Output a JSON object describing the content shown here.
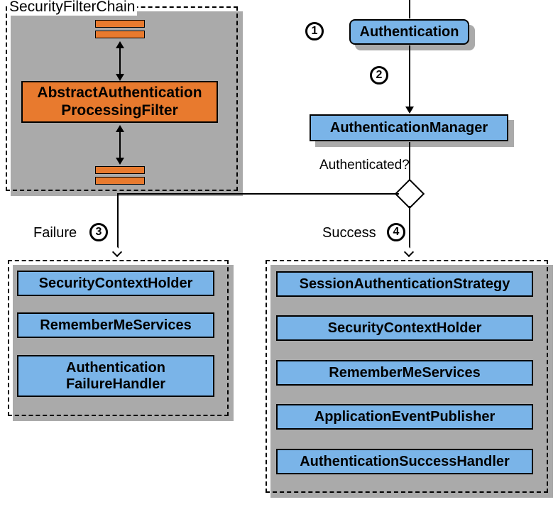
{
  "filterChain": {
    "title": "SecurityFilterChain",
    "mainFilter": "AbstractAuthentication\nProcessingFilter"
  },
  "right": {
    "authentication": "Authentication",
    "authManager": "AuthenticationManager",
    "question": "Authenticated?"
  },
  "steps": {
    "n1": "1",
    "n2": "2",
    "n3": "3",
    "n4": "4"
  },
  "failure": {
    "label": "Failure",
    "items": [
      "SecurityContextHolder",
      "RememberMeServices",
      "Authentication\nFailureHandler"
    ]
  },
  "success": {
    "label": "Success",
    "items": [
      "SessionAuthenticationStrategy",
      "SecurityContextHolder",
      "RememberMeServices",
      "ApplicationEventPublisher",
      "AuthenticationSuccessHandler"
    ]
  },
  "colors": {
    "blue": "#7ab4e8",
    "orange": "#e87a2e"
  }
}
